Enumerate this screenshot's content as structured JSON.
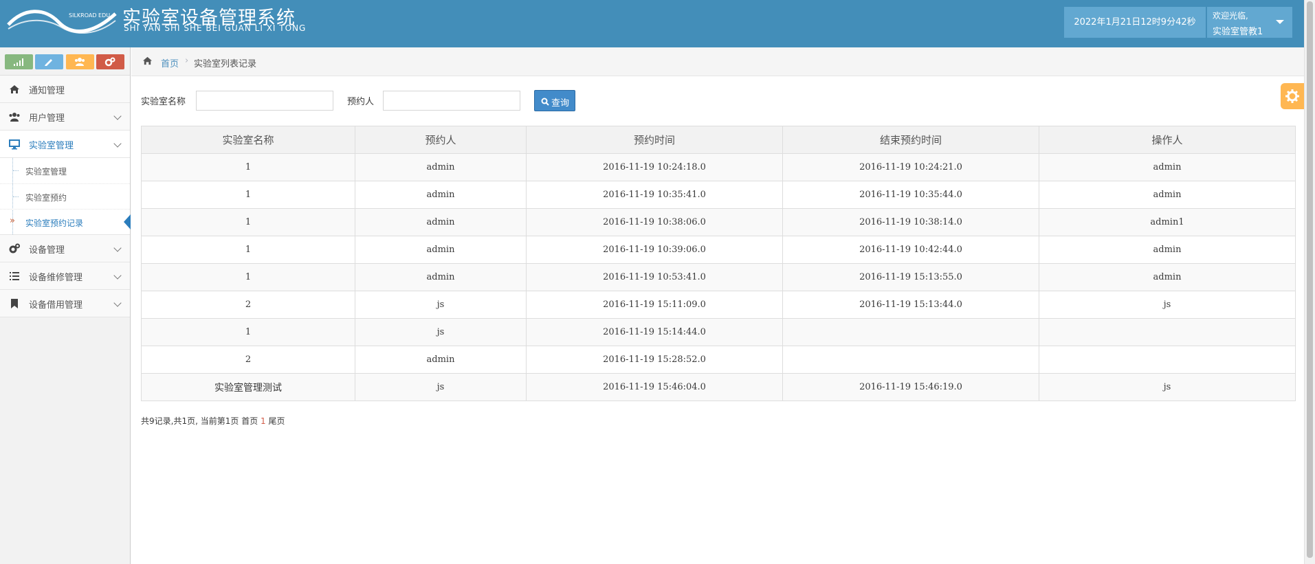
{
  "header": {
    "logo_text": "SILKROAD EDU",
    "title": "实验室设备管理系统",
    "subtitle": "SHI YAN SHI SHE BEI GUAN LI XI TONG",
    "datetime": "2022年1月21日12时9分42秒",
    "welcome": "欢迎光临,",
    "username": "实验室管教1",
    "brand_color": "#438eb9"
  },
  "sidebar": {
    "shortcuts": [
      {
        "icon": "signal-icon",
        "color": "#87b87f"
      },
      {
        "icon": "pencil-icon",
        "color": "#6fb3e0"
      },
      {
        "icon": "users-icon",
        "color": "#ffb752"
      },
      {
        "icon": "cogs-icon",
        "color": "#d15b47"
      }
    ],
    "items": [
      {
        "label": "通知管理",
        "icon": "home-icon"
      },
      {
        "label": "用户管理",
        "icon": "users-icon"
      },
      {
        "label": "实验室管理",
        "icon": "desktop-icon"
      },
      {
        "label": "设备管理",
        "icon": "cogs-icon"
      },
      {
        "label": "设备维修管理",
        "icon": "list-icon"
      },
      {
        "label": "设备借用管理",
        "icon": "bookmark-icon"
      }
    ],
    "submenu": [
      {
        "label": "实验室管理"
      },
      {
        "label": "实验室预约"
      },
      {
        "label": "实验室预约记录",
        "active": true
      }
    ]
  },
  "breadcrumb": {
    "home": "首页",
    "current": "实验室列表记录"
  },
  "search": {
    "label_name": "实验室名称",
    "name_value": "",
    "label_person": "预约人",
    "person_value": "",
    "button": "查询"
  },
  "table": {
    "headers": [
      "实验室名称",
      "预约人",
      "预约时间",
      "结束预约时间",
      "操作人"
    ],
    "rows": [
      [
        "1",
        "admin",
        "2016-11-19 10:24:18.0",
        "2016-11-19 10:24:21.0",
        "admin"
      ],
      [
        "1",
        "admin",
        "2016-11-19 10:35:41.0",
        "2016-11-19 10:35:44.0",
        "admin"
      ],
      [
        "1",
        "admin",
        "2016-11-19 10:38:06.0",
        "2016-11-19 10:38:14.0",
        "admin1"
      ],
      [
        "1",
        "admin",
        "2016-11-19 10:39:06.0",
        "2016-11-19 10:42:44.0",
        "admin"
      ],
      [
        "1",
        "admin",
        "2016-11-19 10:53:41.0",
        "2016-11-19 15:13:55.0",
        "admin"
      ],
      [
        "2",
        "js",
        "2016-11-19 15:11:09.0",
        "2016-11-19 15:13:44.0",
        "js"
      ],
      [
        "1",
        "js",
        "2016-11-19 15:14:44.0",
        "",
        ""
      ],
      [
        "2",
        "admin",
        "2016-11-19 15:28:52.0",
        "",
        ""
      ],
      [
        "实验室管理测试",
        "js",
        "2016-11-19 15:46:04.0",
        "2016-11-19 15:46:19.0",
        "js"
      ]
    ]
  },
  "pagination": {
    "summary": "共9记录,共1页, 当前第1页",
    "first": "首页",
    "current_page": "1",
    "last": "尾页"
  }
}
